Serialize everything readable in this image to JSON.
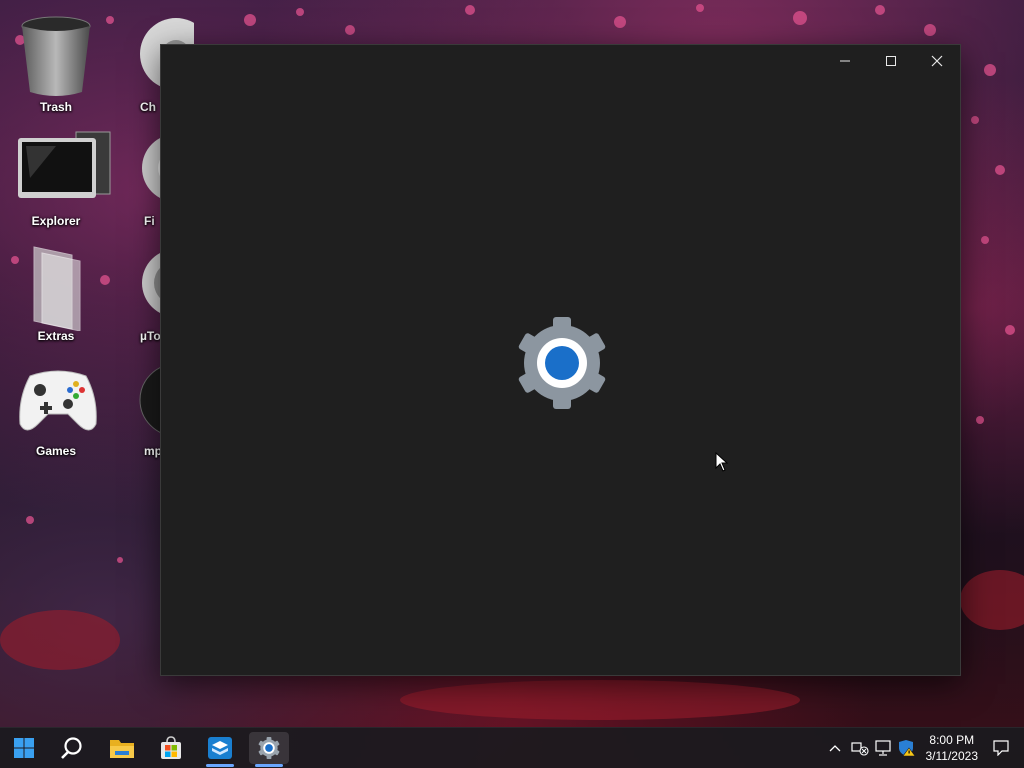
{
  "desktop": {
    "icons": [
      {
        "label": "Trash"
      },
      {
        "label": "Explorer"
      },
      {
        "label": "Extras"
      },
      {
        "label": "Games"
      },
      {
        "label": "Ch"
      },
      {
        "label": "Fi"
      },
      {
        "label": "µTo"
      },
      {
        "label": "mp"
      }
    ]
  },
  "window": {
    "controls": [
      "minimize-icon",
      "maximize-icon",
      "close-icon"
    ],
    "splash_icon": "settings-gear-icon",
    "accent": "#1a6fc9"
  },
  "taskbar": {
    "buttons": [
      "windows-start-icon",
      "search-icon",
      "file-explorer-icon",
      "store-icon",
      "virtualbox-icon",
      "settings-icon"
    ],
    "active": "settings-icon",
    "tray": [
      "chevron-up-icon",
      "network-disconnected-icon",
      "network-icon",
      "security-shield-icon",
      "notification-icon"
    ],
    "clock": {
      "time": "8:00 PM",
      "date": "3/11/2023"
    }
  }
}
